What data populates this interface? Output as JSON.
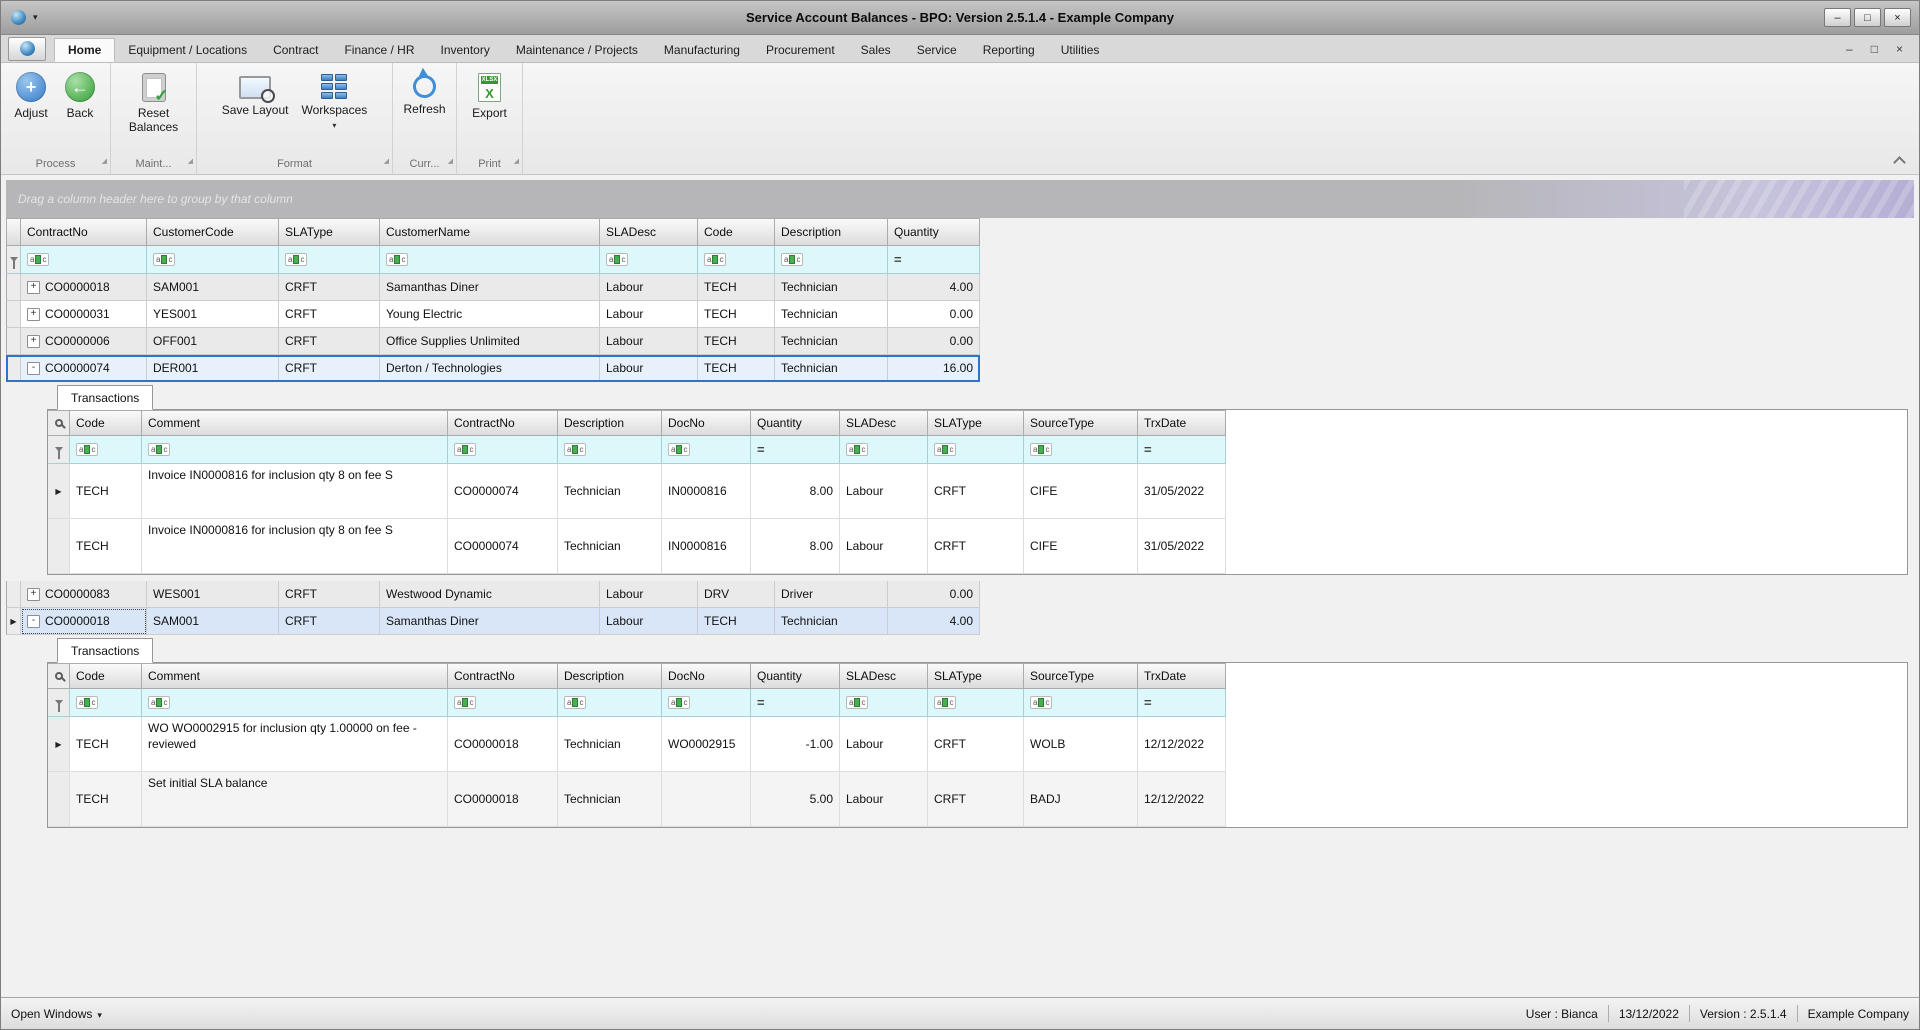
{
  "window": {
    "title": "Service Account Balances - BPO: Version 2.5.1.4 - Example Company"
  },
  "menu_tabs": [
    "Home",
    "Equipment / Locations",
    "Contract",
    "Finance / HR",
    "Inventory",
    "Maintenance / Projects",
    "Manufacturing",
    "Procurement",
    "Sales",
    "Service",
    "Reporting",
    "Utilities"
  ],
  "ribbon": {
    "buttons": [
      {
        "label": "Adjust",
        "icon": "add-circle"
      },
      {
        "label": "Back",
        "icon": "back-circle"
      },
      {
        "label": "Reset Balances",
        "icon": "clipboard-check"
      },
      {
        "label": "Save Layout",
        "icon": "monitor-search"
      },
      {
        "label": "Workspaces",
        "icon": "workspace-grid"
      },
      {
        "label": "Refresh",
        "icon": "refresh-arrows"
      },
      {
        "label": "Export",
        "icon": "xlsx-file"
      }
    ],
    "xlsx_badge": "XLSX",
    "groups": [
      {
        "label": "Process"
      },
      {
        "label": "Maint..."
      },
      {
        "label": "Format"
      },
      {
        "label": "Curr..."
      },
      {
        "label": "Print"
      }
    ]
  },
  "group_by_hint": "Drag a column header here to group by that column",
  "main_grid": {
    "columns": [
      "ContractNo",
      "CustomerCode",
      "SLAType",
      "CustomerName",
      "SLADesc",
      "Code",
      "Description",
      "Quantity"
    ],
    "rows": [
      {
        "expander": "+",
        "cells": [
          "CO0000018",
          "SAM001",
          "CRFT",
          "Samanthas Diner",
          "Labour",
          "TECH",
          "Technician",
          "4.00"
        ]
      },
      {
        "expander": "+",
        "cells": [
          "CO0000031",
          "YES001",
          "CRFT",
          "Young Electric",
          "Labour",
          "TECH",
          "Technician",
          "0.00"
        ]
      },
      {
        "expander": "+",
        "cells": [
          "CO0000006",
          "OFF001",
          "CRFT",
          "Office Supplies Unlimited",
          "Labour",
          "TECH",
          "Technician",
          "0.00"
        ]
      },
      {
        "expander": "-",
        "cells": [
          "CO0000074",
          "DER001",
          "CRFT",
          "Derton / Technologies",
          "Labour",
          "TECH",
          "Technician",
          "16.00"
        ]
      },
      {
        "expander": "+",
        "cells": [
          "CO0000083",
          "WES001",
          "CRFT",
          "Westwood Dynamic",
          "Labour",
          "DRV",
          "Driver",
          "0.00"
        ]
      },
      {
        "expander": "-",
        "cells": [
          "CO0000018",
          "SAM001",
          "CRFT",
          "Samanthas Diner",
          "Labour",
          "TECH",
          "Technician",
          "4.00"
        ]
      }
    ]
  },
  "detail_tab_label": "Transactions",
  "detail_columns": [
    "Code",
    "Comment",
    "ContractNo",
    "Description",
    "DocNo",
    "Quantity",
    "SLADesc",
    "SLAType",
    "SourceType",
    "TrxDate"
  ],
  "detail1": {
    "rows": [
      {
        "cells": [
          "TECH",
          "Invoice IN0000816 for inclusion qty 8 on fee S",
          "CO0000074",
          "Technician",
          "IN0000816",
          "8.00",
          "Labour",
          "CRFT",
          "CIFE",
          "31/05/2022"
        ]
      },
      {
        "cells": [
          "TECH",
          "Invoice IN0000816 for inclusion qty 8 on fee S",
          "CO0000074",
          "Technician",
          "IN0000816",
          "8.00",
          "Labour",
          "CRFT",
          "CIFE",
          "31/05/2022"
        ]
      }
    ]
  },
  "detail2": {
    "rows": [
      {
        "cells": [
          "TECH",
          "WO WO0002915 for inclusion qty 1.00000 on fee - reviewed",
          "CO0000018",
          "Technician",
          "WO0002915",
          "-1.00",
          "Labour",
          "CRFT",
          "WOLB",
          "12/12/2022"
        ]
      },
      {
        "cells": [
          "TECH",
          "Set initial SLA balance",
          "CO0000018",
          "Technician",
          "",
          "5.00",
          "Labour",
          "CRFT",
          "BADJ",
          "12/12/2022"
        ]
      }
    ]
  },
  "status_bar": {
    "open_windows": "Open Windows",
    "user": "User : Bianca",
    "date": "13/12/2022",
    "version": "Version : 2.5.1.4",
    "company": "Example Company"
  },
  "colors": {
    "accent_blue": "#2e75c8",
    "filter_row_bg": "#ddf8fa",
    "selected_row_bg": "#d8e6f7"
  }
}
